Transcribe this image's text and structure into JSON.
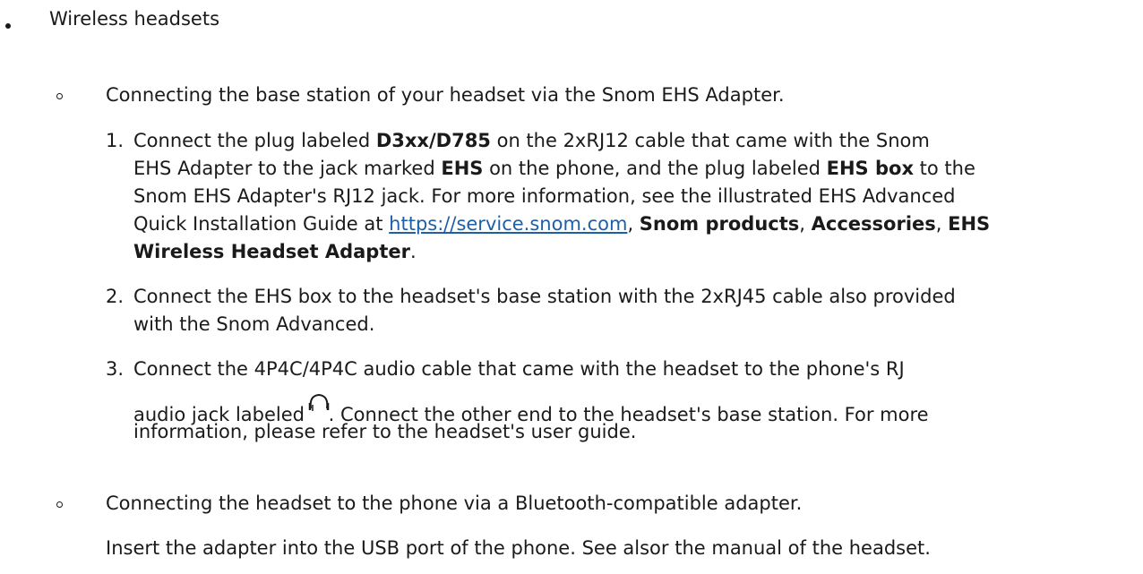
{
  "level1": {
    "label": "Wireless headsets"
  },
  "section_a": {
    "title": "Connecting the base station of your headset via the Snom EHS Adapter.",
    "step1": {
      "num": "1.",
      "t1": "Connect the plug labeled ",
      "b1": "D3xx/D785",
      "t2": " on the 2xRJ12 cable that came with the Snom",
      "t3": "EHS Adapter to the jack marked ",
      "b2": "EHS",
      "t4": " on the phone, and the plug labeled ",
      "b3": "EHS box",
      "t5": " to the",
      "t6": "Snom EHS Adapter's RJ12 jack.  For more information, see the illustrated EHS Advanced",
      "t7": "Quick Installation Guide at ",
      "link": "https://service.snom.com",
      "t8": ", ",
      "b4": "Snom products",
      "t9": ",  ",
      "b5": "Accessories",
      "t10": ", ",
      "b6": "EHS",
      "b7": "Wireless Headset Adapter",
      "t11": "."
    },
    "step2": {
      "num": "2.",
      "t1": "Connect the EHS box to the headset's base station with the 2xRJ45 cable also provided",
      "t2": "with the Snom Advanced."
    },
    "step3": {
      "num": "3.",
      "t1": "Connect the 4P4C/4P4C audio cable that came with the headset to the phone's RJ",
      "t2a": "audio jack labeled ",
      "icon": "headset-icon",
      "t2b": ". Connect the other end to the headset's base station.  For more",
      "t3": "information, please refer to the headset's user guide."
    }
  },
  "section_b": {
    "title": "Connecting the headset to the phone via a Bluetooth-compatible adapter.",
    "body": "Insert the adapter into the USB port of the phone.  See alsor the manual of the headset."
  }
}
